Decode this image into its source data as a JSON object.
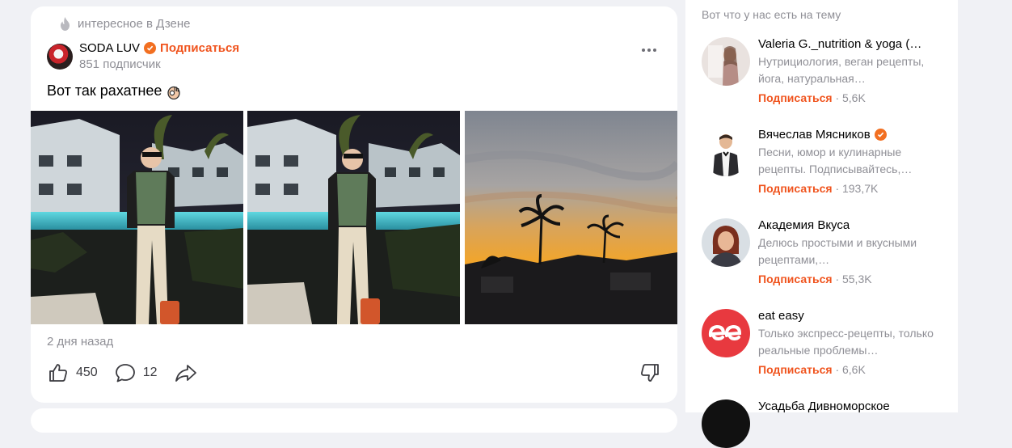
{
  "post": {
    "source_label": "интересное в Дзене",
    "author_name": "SODA LUV",
    "subscribe_label": "Подписаться",
    "subscribers": "851 подписчик",
    "text": "Вот так рахатнее",
    "text_emoji_icon": "ok-hand-icon",
    "time": "2 дня назад",
    "likes": "450",
    "comments": "12"
  },
  "sidebar": {
    "title": "Вот что у нас есть на тему",
    "channels": [
      {
        "name": "Valeria G._nutrition & yoga (…",
        "desc": "Нутрициология, веган рецепты, йога, натуральная…",
        "subscribe": "Подписаться",
        "count": "· 5,6K",
        "verified": false
      },
      {
        "name": "Вячеслав Мясников",
        "desc": "Песни, юмор и кулинарные рецепты. Подписывайтесь,…",
        "subscribe": "Подписаться",
        "count": "· 193,7K",
        "verified": true
      },
      {
        "name": "Академия Вкуса",
        "desc": "Делюсь простыми и вкусными рецептами,…",
        "subscribe": "Подписаться",
        "count": "· 55,3K",
        "verified": false
      },
      {
        "name": "eat easy",
        "desc": "Только экспресс-рецепты, только реальные проблемы…",
        "subscribe": "Подписаться",
        "count": "· 6,6K",
        "verified": false
      },
      {
        "name": "Усадьба Дивноморское",
        "desc": "",
        "subscribe": "",
        "count": "",
        "verified": false
      }
    ]
  },
  "colors": {
    "accent": "#f0541e",
    "verified": "#f26f21",
    "muted": "#8f8f96",
    "background": "#f0f1f5"
  }
}
